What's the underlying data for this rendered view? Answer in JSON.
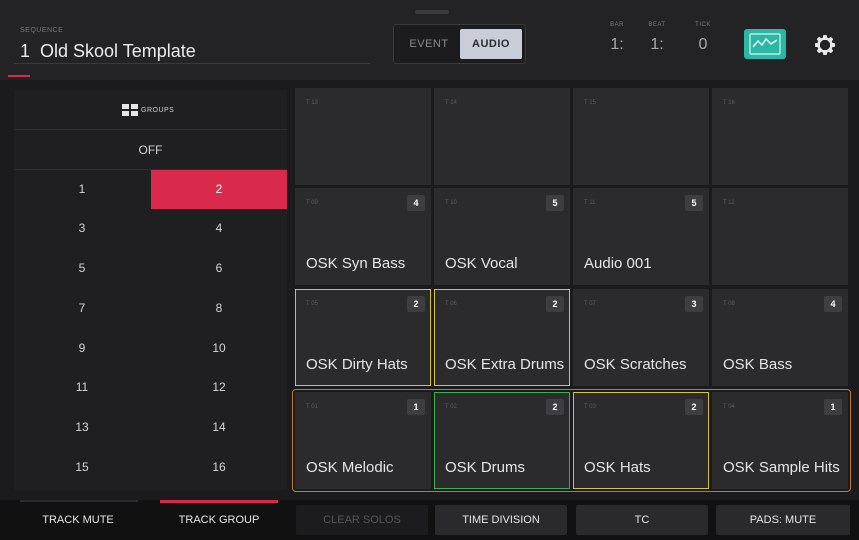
{
  "header": {
    "sequence_label": "SEQUENCE",
    "sequence_number": "1",
    "sequence_name": "Old Skool Template",
    "mode_event": "EVENT",
    "mode_audio": "AUDIO",
    "counters": [
      {
        "label": "BAR",
        "value": "1:"
      },
      {
        "label": "BEAT",
        "value": "1:"
      },
      {
        "label": "TICK",
        "value": "0"
      }
    ],
    "waveform_icon": "waveform-icon",
    "settings_icon": "gear-icon"
  },
  "groups": {
    "header_label": "GROUPS",
    "off_label": "OFF",
    "items": [
      "1",
      "2",
      "3",
      "4",
      "5",
      "6",
      "7",
      "8",
      "9",
      "10",
      "11",
      "12",
      "13",
      "14",
      "15",
      "16"
    ],
    "selected": "2"
  },
  "pads": [
    {
      "track": "T 13",
      "badge": "",
      "name": ""
    },
    {
      "track": "T 14",
      "badge": "",
      "name": ""
    },
    {
      "track": "T 15",
      "badge": "",
      "name": ""
    },
    {
      "track": "T 16",
      "badge": "",
      "name": ""
    },
    {
      "track": "T 09",
      "badge": "4",
      "name": "OSK Syn Bass"
    },
    {
      "track": "T 10",
      "badge": "5",
      "name": "OSK Vocal"
    },
    {
      "track": "T 11",
      "badge": "5",
      "name": "Audio 001"
    },
    {
      "track": "T 12",
      "badge": "",
      "name": ""
    },
    {
      "track": "T 05",
      "badge": "2",
      "name": "OSK Dirty Hats"
    },
    {
      "track": "T 06",
      "badge": "2",
      "name": "OSK Extra Drums"
    },
    {
      "track": "T 07",
      "badge": "3",
      "name": "OSK Scratches"
    },
    {
      "track": "T 08",
      "badge": "4",
      "name": "OSK Bass"
    },
    {
      "track": "T 01",
      "badge": "1",
      "name": "OSK Melodic"
    },
    {
      "track": "T 02",
      "badge": "2",
      "name": "OSK Drums"
    },
    {
      "track": "T 03",
      "badge": "2",
      "name": "OSK Hats"
    },
    {
      "track": "T 04",
      "badge": "1",
      "name": "OSK Sample Hits"
    }
  ],
  "bottom_bar": {
    "track_mute": "TRACK MUTE",
    "track_group": "TRACK GROUP",
    "clear_solos": "CLEAR SOLOS",
    "time_division": "TIME DIVISION",
    "tc": "TC",
    "pads_mute": "PADS: MUTE"
  },
  "colors": {
    "accent_red": "#d92a4c",
    "waveform_teal": "#28b8a5",
    "pad_border_yellow": "#d4c43a",
    "pad_border_green": "#36b34a",
    "row_frame_orange": "#c07a2e"
  }
}
